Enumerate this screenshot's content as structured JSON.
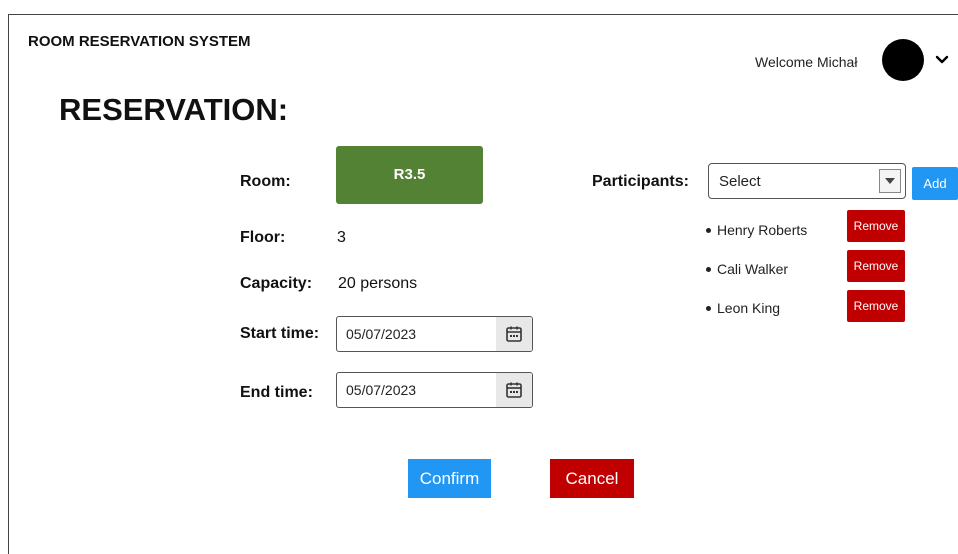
{
  "header": {
    "app_title": "ROOM RESERVATION SYSTEM",
    "welcome_text": "Welcome Michał"
  },
  "page_title": "RESERVATION:",
  "form": {
    "room_label": "Room:",
    "room_value": "R3.5",
    "floor_label": "Floor:",
    "floor_value": "3",
    "capacity_label": "Capacity:",
    "capacity_value": "20 persons",
    "start_label": "Start time:",
    "start_value": "05/07/2023",
    "end_label": "End time:",
    "end_value": "05/07/2023"
  },
  "participants": {
    "label": "Participants:",
    "select_value": "Select",
    "add_label": "Add",
    "remove_label": "Remove",
    "items": [
      {
        "name": "Henry Roberts"
      },
      {
        "name": "Cali Walker"
      },
      {
        "name": "Leon King"
      }
    ]
  },
  "actions": {
    "confirm_label": "Confirm",
    "cancel_label": "Cancel"
  },
  "colors": {
    "room_button": "#548235",
    "primary_button": "#2196f3",
    "danger_button": "#c00000"
  },
  "icons": {
    "avatar": "avatar",
    "user_menu": "chevron-down-icon",
    "date_picker": "calendar-icon",
    "select_arrow": "caret-down-icon"
  }
}
